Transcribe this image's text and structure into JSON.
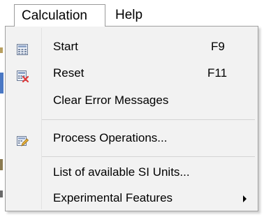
{
  "menubar": {
    "items": [
      {
        "label": "Calculation"
      },
      {
        "label": "Help"
      }
    ]
  },
  "calculation_menu": {
    "items": [
      {
        "label": "Start",
        "shortcut": "F9",
        "icon": "calculator-grid-icon"
      },
      {
        "label": "Reset",
        "shortcut": "F11",
        "icon": "calculator-reset-icon"
      },
      {
        "label": "Clear Error Messages",
        "shortcut": ""
      },
      {
        "label": "Process Operations...",
        "shortcut": "",
        "icon": "process-edit-icon"
      },
      {
        "label": "List of available SI Units...",
        "shortcut": ""
      },
      {
        "label": "Experimental Features",
        "shortcut": "",
        "submenu": true
      }
    ]
  },
  "colors": {
    "menu_background": "#f2f2f2",
    "menu_border": "#a0a0a0",
    "reset_icon_accent": "#e03a3a",
    "process_icon_accent": "#e8b23a"
  }
}
